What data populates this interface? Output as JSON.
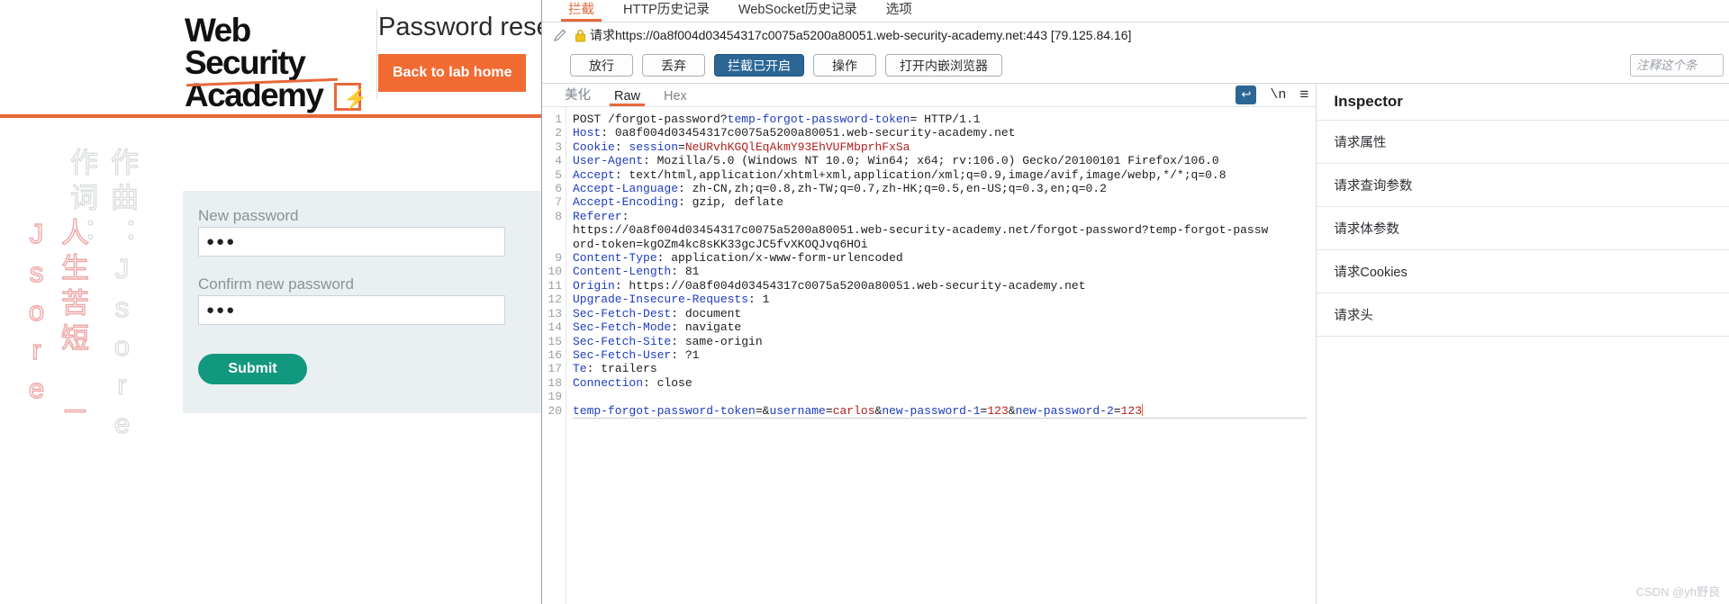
{
  "browser_page": {
    "logo": {
      "line1": "Web Security",
      "line2": "Academy",
      "bolt_glyph": "⚡"
    },
    "page_title": "Password reset",
    "lab_home_button": "Back to lab home",
    "watermark": {
      "col1": "人生苦短 － Jsore",
      "col2": "作曲：Jsore 作词："
    },
    "form": {
      "new_password_label": "New password",
      "new_password_value": "●●●",
      "confirm_password_label": "Confirm new password",
      "confirm_password_value": "●●●",
      "submit_label": "Submit",
      "submit_color": "#12987f"
    },
    "accent_color": "#e8683a"
  },
  "burp": {
    "tabs": [
      {
        "label": "拦截",
        "active": true
      },
      {
        "label": "HTTP历史记录",
        "active": false
      },
      {
        "label": "WebSocket历史记录",
        "active": false
      },
      {
        "label": "选项",
        "active": false
      }
    ],
    "urlbar": {
      "pencil_icon": "pencil-icon",
      "lock_icon": "lock-icon",
      "text": "请求https://0a8f004d03454317c0075a5200a80051.web-security-academy.net:443  [79.125.84.16]"
    },
    "actions": [
      {
        "label": "放行",
        "primary": false
      },
      {
        "label": "丢弃",
        "primary": false
      },
      {
        "label": "拦截已开启",
        "primary": true
      },
      {
        "label": "操作",
        "primary": false
      },
      {
        "label": "打开内嵌浏览器",
        "primary": false
      }
    ],
    "note_placeholder": "注释这个条",
    "view_tabs": [
      {
        "label": "美化",
        "active": false
      },
      {
        "label": "Raw",
        "active": true
      },
      {
        "label": "Hex",
        "active": false
      }
    ],
    "view_icons": [
      {
        "name": "word-wrap-icon",
        "glyph": "↩"
      },
      {
        "name": "newline-icon",
        "glyph": "\\n"
      },
      {
        "name": "menu-icon",
        "glyph": "≡"
      }
    ],
    "accent_active": "#e8683a",
    "primary_button_color": "#2b6695",
    "request": {
      "lines": [
        {
          "n": 1,
          "html": "<span class=\"pl\">POST /forgot-password?</span><span class=\"pk\">temp-forgot-password-token</span><span class=\"pl\">= HTTP/1.1</span>"
        },
        {
          "n": 2,
          "html": "<span class=\"hk\">Host</span><span class=\"pl\">: 0a8f004d03454317c0075a5200a80051.web-security-academy.net</span>"
        },
        {
          "n": 3,
          "html": "<span class=\"hk\">Cookie</span><span class=\"pl\">: </span><span class=\"pk\">session</span><span class=\"pl\">=</span><span class=\"pv\">NeURvhKGQlEqAkmY93EhVUFMbprhFxSa</span>"
        },
        {
          "n": 4,
          "html": "<span class=\"hk\">User-Agent</span><span class=\"pl\">: Mozilla/5.0 (Windows NT 10.0; Win64; x64; rv:106.0) Gecko/20100101 Firefox/106.0</span>"
        },
        {
          "n": 5,
          "html": "<span class=\"hk\">Accept</span><span class=\"pl\">: text/html,application/xhtml+xml,application/xml;q=0.9,image/avif,image/webp,*/*;q=0.8</span>"
        },
        {
          "n": 6,
          "html": "<span class=\"hk\">Accept-Language</span><span class=\"pl\">: zh-CN,zh;q=0.8,zh-TW;q=0.7,zh-HK;q=0.5,en-US;q=0.3,en;q=0.2</span>"
        },
        {
          "n": 7,
          "html": "<span class=\"hk\">Accept-Encoding</span><span class=\"pl\">: gzip, deflate</span>"
        },
        {
          "n": 8,
          "html": "<span class=\"hk\">Referer</span><span class=\"pl\">:</span>"
        },
        {
          "n": "",
          "html": "<span class=\"pl\">https://0a8f004d03454317c0075a5200a80051.web-security-academy.net/forgot-password?temp-forgot-passw</span>"
        },
        {
          "n": "",
          "html": "<span class=\"pl\">ord-token=kgOZm4kc8sKK33gcJC5fvXKOQJvq6HOi</span>"
        },
        {
          "n": 9,
          "html": "<span class=\"hk\">Content-Type</span><span class=\"pl\">: application/x-www-form-urlencoded</span>"
        },
        {
          "n": 10,
          "html": "<span class=\"hk\">Content-Length</span><span class=\"pl\">: 81</span>"
        },
        {
          "n": 11,
          "html": "<span class=\"hk\">Origin</span><span class=\"pl\">: https://0a8f004d03454317c0075a5200a80051.web-security-academy.net</span>"
        },
        {
          "n": 12,
          "html": "<span class=\"hk\">Upgrade-Insecure-Requests</span><span class=\"pl\">: 1</span>"
        },
        {
          "n": 13,
          "html": "<span class=\"hk\">Sec-Fetch-Dest</span><span class=\"pl\">: document</span>"
        },
        {
          "n": 14,
          "html": "<span class=\"hk\">Sec-Fetch-Mode</span><span class=\"pl\">: navigate</span>"
        },
        {
          "n": 15,
          "html": "<span class=\"hk\">Sec-Fetch-Site</span><span class=\"pl\">: same-origin</span>"
        },
        {
          "n": 16,
          "html": "<span class=\"hk\">Sec-Fetch-User</span><span class=\"pl\">: ?1</span>"
        },
        {
          "n": 17,
          "html": "<span class=\"hk\">Te</span><span class=\"pl\">: trailers</span>"
        },
        {
          "n": 18,
          "html": "<span class=\"hk\">Connection</span><span class=\"pl\">: close</span>"
        },
        {
          "n": 19,
          "html": ""
        },
        {
          "n": 20,
          "html": "<span class=\"pk\">temp-forgot-password-token</span><span class=\"pl\">=&amp;</span><span class=\"pk\">username</span><span class=\"pl\">=</span><span class=\"pv\">carlos</span><span class=\"pl\">&amp;</span><span class=\"pk\">new-password-1</span><span class=\"pl\">=</span><span class=\"pv\">123</span><span class=\"pl\">&amp;</span><span class=\"pk\">new-password-2</span><span class=\"pl\">=</span><span class=\"pv\">123</span><span class=\"caret\"></span>",
          "body": true
        }
      ]
    },
    "inspector": {
      "title": "Inspector",
      "items": [
        {
          "label": "请求属性"
        },
        {
          "label": "请求查询参数"
        },
        {
          "label": "请求体参数"
        },
        {
          "label": "请求Cookies"
        },
        {
          "label": "请求头"
        }
      ]
    }
  },
  "watermark_bottom": "CSDN @yh野良"
}
